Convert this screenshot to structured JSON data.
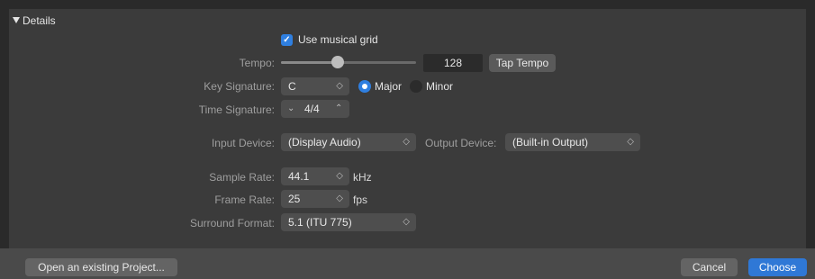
{
  "details": {
    "label": "Details"
  },
  "musical_grid": {
    "label": "Use musical grid",
    "checked": true
  },
  "tempo": {
    "label": "Tempo:",
    "value": "128",
    "tap_label": "Tap Tempo",
    "slider_fraction": 0.42
  },
  "key_signature": {
    "label": "Key Signature:",
    "value": "C",
    "major_label": "Major",
    "minor_label": "Minor",
    "selected": "Major"
  },
  "time_signature": {
    "label": "Time Signature:",
    "value": "4/4"
  },
  "input_device": {
    "label": "Input Device:",
    "value": "(Display Audio)"
  },
  "output_device": {
    "label": "Output Device:",
    "value": "(Built-in Output)"
  },
  "sample_rate": {
    "label": "Sample Rate:",
    "value": "44.1",
    "unit": "kHz"
  },
  "frame_rate": {
    "label": "Frame Rate:",
    "value": "25",
    "unit": "fps"
  },
  "surround_format": {
    "label": "Surround Format:",
    "value": "5.1 (ITU 775)"
  },
  "footer": {
    "open_label": "Open an existing Project...",
    "cancel_label": "Cancel",
    "choose_label": "Choose"
  },
  "colors": {
    "accent": "#2f7fe0",
    "panel": "#3b3b3b",
    "footer": "#4a4a4a"
  }
}
